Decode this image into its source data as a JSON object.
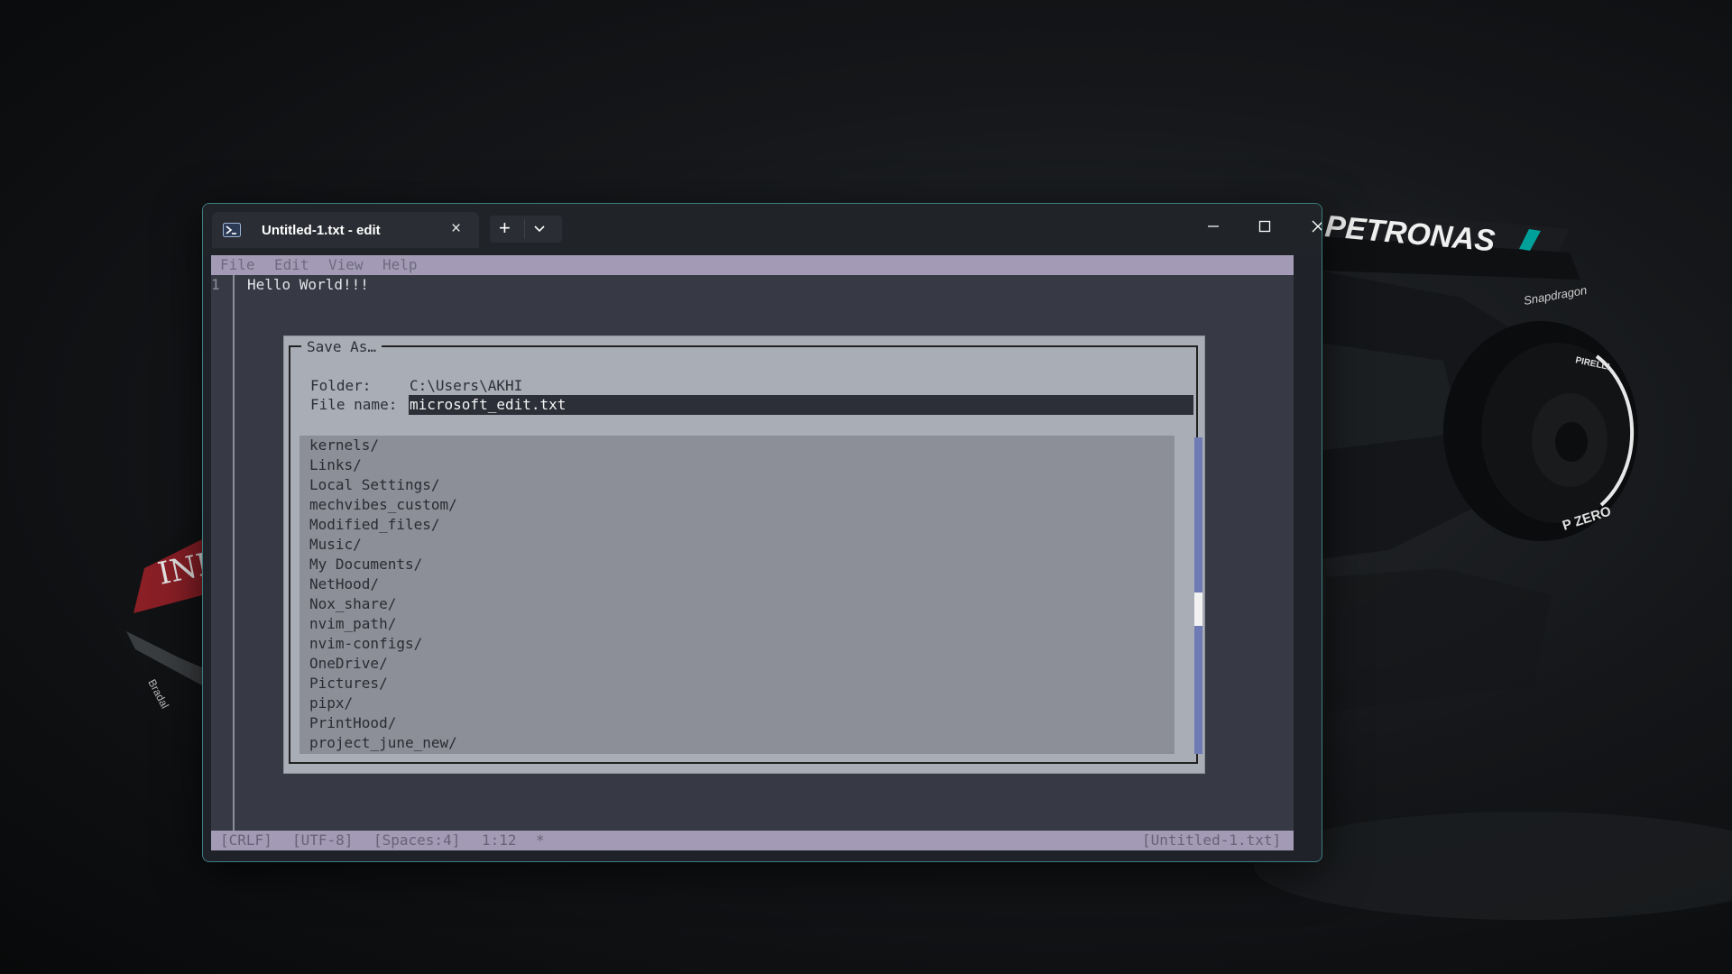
{
  "window": {
    "tab_title": "Untitled-1.txt - edit",
    "tab_icon": "powershell-icon",
    "close_tab_icon": "×"
  },
  "menu": {
    "items": [
      "File",
      "Edit",
      "View",
      "Help"
    ]
  },
  "editor": {
    "line_number": "1",
    "line_text": "Hello World!!!"
  },
  "dialog": {
    "title": "Save As…",
    "folder_label": "Folder:",
    "folder_value": "C:\\Users\\AKHI",
    "filename_label": "File name:",
    "filename_value": "microsoft_edit.txt",
    "files": [
      "kernels/",
      "Links/",
      "Local Settings/",
      "mechvibes_custom/",
      "Modified_files/",
      "Music/",
      "My Documents/",
      "NetHood/",
      "Nox_share/",
      "nvim_path/",
      "nvim-configs/",
      "OneDrive/",
      "Pictures/",
      "pipx/",
      "PrintHood/",
      "project_june_new/"
    ]
  },
  "status": {
    "line_ending": "[CRLF]",
    "encoding": "[UTF-8]",
    "indent": "[Spaces:4]",
    "position": "1:12",
    "modified": "*",
    "filename": "[Untitled-1.txt]"
  },
  "wallpaper": {
    "brand_text": "PETRONAS",
    "sponsor_text": "Snapdragon",
    "tyre_text": "PIRELLI",
    "tyre_compound": "P ZERO",
    "wing_text": "INEOS"
  },
  "colors": {
    "menubar": "#a39bb5",
    "editor_bg": "#373a45",
    "dialog_bg": "#a9adb6",
    "accent_border": "#3d7d80",
    "scrollbar": "#6e7bb5"
  }
}
